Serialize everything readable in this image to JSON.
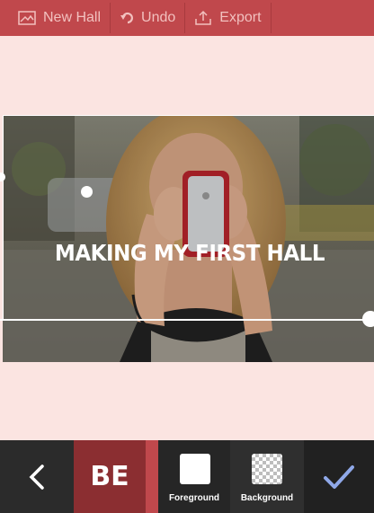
{
  "toolbar": {
    "new_hall": "New Hall",
    "undo": "Undo",
    "export": "Export",
    "icons": [
      "image-icon",
      "undo-icon",
      "export-icon"
    ]
  },
  "canvas": {
    "caption": "MAKING MY FIRST HALL"
  },
  "bottombar": {
    "font_preview": "BE",
    "foreground_label": "Foreground",
    "background_label": "Background",
    "foreground_color": "#ffffff",
    "icons": [
      "back-chevron-icon",
      "checkmark-icon"
    ]
  },
  "colors": {
    "toolbar": "#c0484c",
    "canvas_bg": "#fbe4e1",
    "font_tile": "#8b2e31",
    "confirm_check": "#8fa8e8"
  }
}
